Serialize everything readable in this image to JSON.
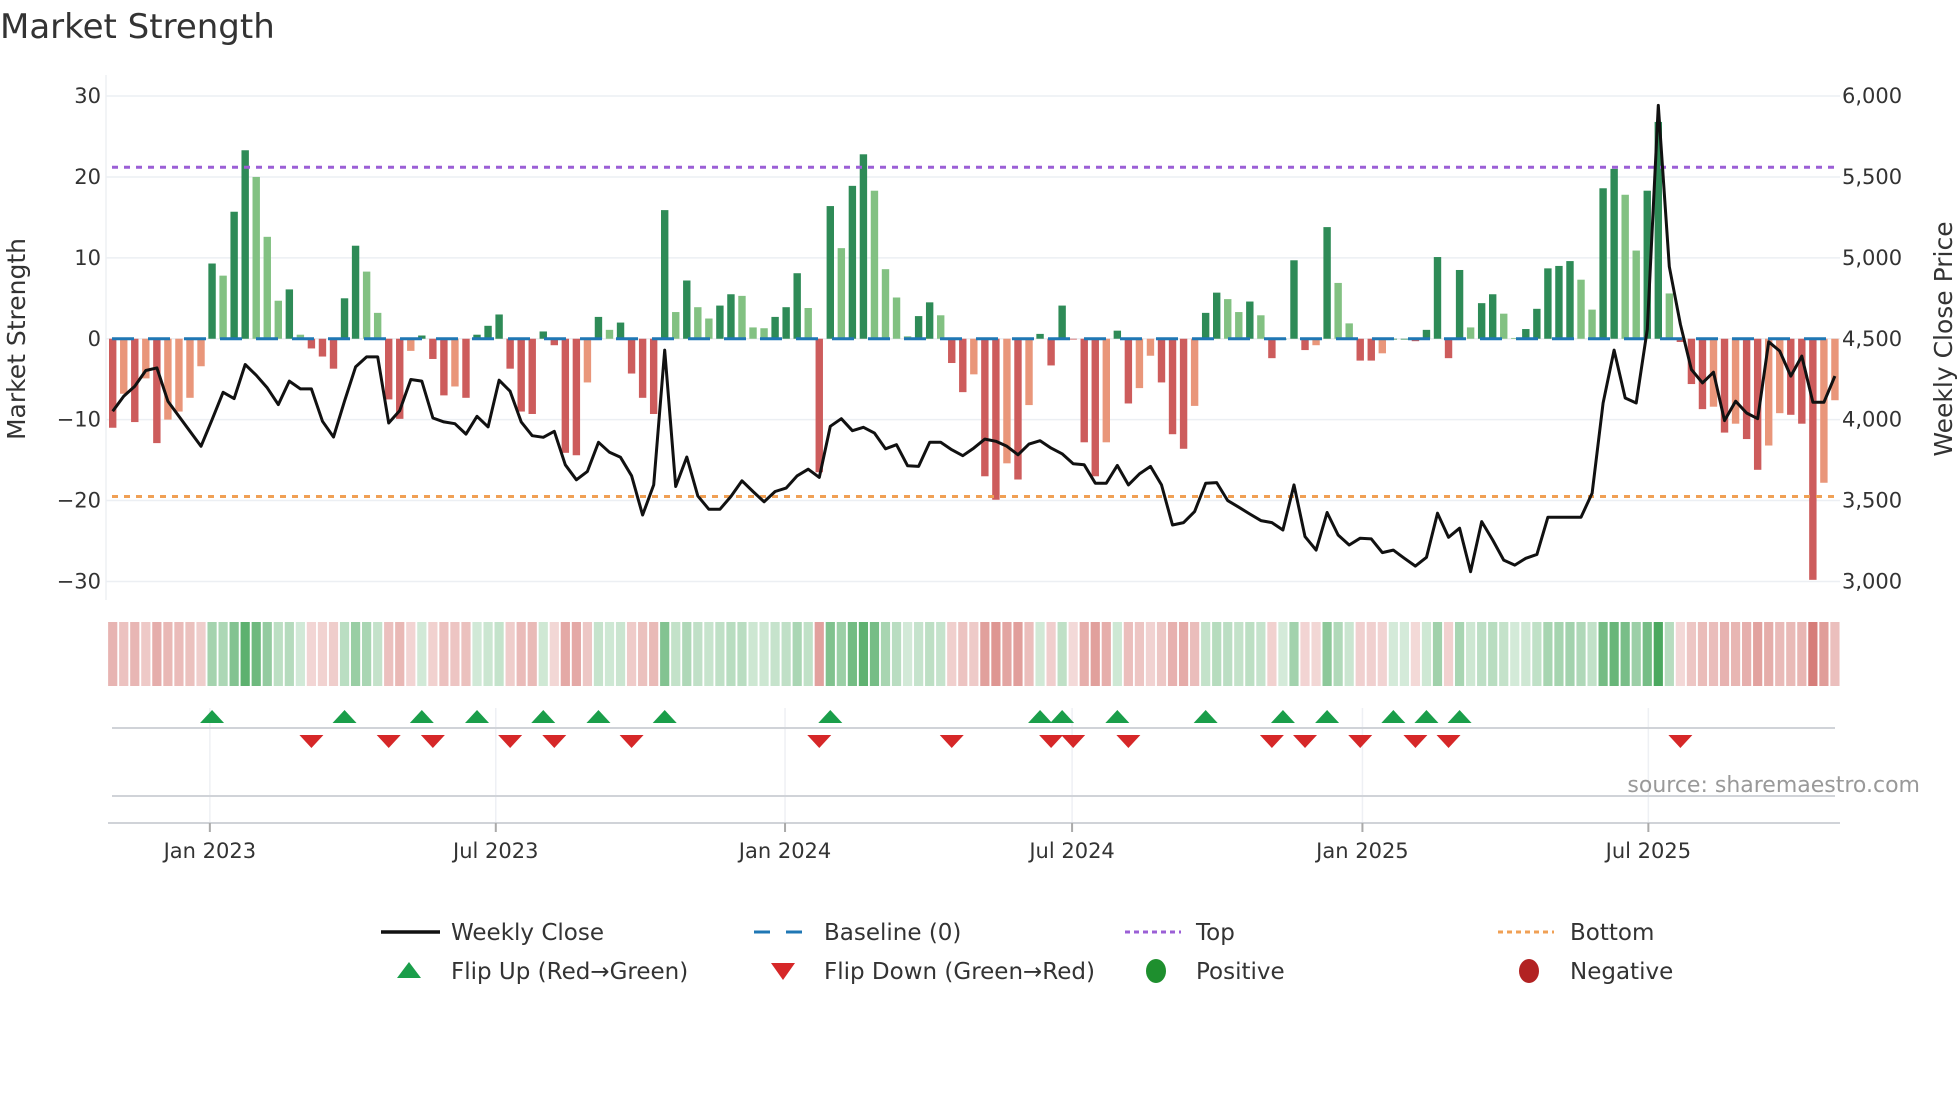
{
  "chart_data": {
    "type": "bar",
    "title": "Market Strength",
    "ylabel": "Market Strength",
    "y2label": "Weekly Close Price",
    "ylim": [
      -30,
      30
    ],
    "y2lim": [
      3000,
      6000
    ],
    "y_ticks": [
      "30",
      "20",
      "10",
      "0",
      "−10",
      "−20",
      "−30"
    ],
    "y_tick_values": [
      30,
      20,
      10,
      0,
      -10,
      -20,
      -30
    ],
    "y2_ticks": [
      "6,000",
      "5,500",
      "5,000",
      "4,500",
      "4,000",
      "3,500",
      "3,000"
    ],
    "y2_tick_values": [
      6000,
      5500,
      5000,
      4500,
      4000,
      3500,
      3000
    ],
    "x_ticks": [
      {
        "label": "Jan 2023",
        "week_index": 8.8
      },
      {
        "label": "Jul 2023",
        "week_index": 34.7
      },
      {
        "label": "Jan 2024",
        "week_index": 60.9
      },
      {
        "label": "Jul 2024",
        "week_index": 86.9
      },
      {
        "label": "Jan 2025",
        "week_index": 113.2
      },
      {
        "label": "Jul 2025",
        "week_index": 139.1
      }
    ],
    "top_level": 21.2,
    "bottom_level": -19.5,
    "baseline": 0,
    "strength": [
      -11.0,
      -6.8,
      -10.3,
      -4.9,
      -12.9,
      -10.0,
      -9.0,
      -7.3,
      -3.4,
      9.3,
      7.8,
      15.7,
      23.3,
      20.0,
      12.6,
      4.7,
      6.1,
      0.5,
      -1.2,
      -2.2,
      -3.7,
      5.0,
      11.5,
      8.3,
      3.2,
      -7.5,
      -9.9,
      -1.5,
      0.4,
      -2.5,
      -7.0,
      -5.9,
      -7.3,
      0.5,
      1.6,
      3.0,
      -3.7,
      -9.0,
      -9.3,
      0.9,
      -0.8,
      -14.1,
      -14.4,
      -5.4,
      2.7,
      1.1,
      2.0,
      -4.3,
      -7.3,
      -9.3,
      15.9,
      3.3,
      7.2,
      3.9,
      2.5,
      4.1,
      5.5,
      5.3,
      1.4,
      1.3,
      2.7,
      3.9,
      8.1,
      3.8,
      -16.5,
      16.4,
      11.2,
      18.9,
      22.8,
      18.3,
      8.6,
      5.1,
      0.3,
      2.8,
      4.5,
      2.9,
      -3.0,
      -6.6,
      -4.4,
      -17.0,
      -19.9,
      -15.4,
      -17.4,
      -8.2,
      0.6,
      -3.3,
      4.1,
      -0.1,
      -12.8,
      -17.0,
      -12.8,
      1.0,
      -8.0,
      -6.1,
      -2.1,
      -5.4,
      -11.8,
      -13.6,
      -8.3,
      3.2,
      5.7,
      4.9,
      3.3,
      4.6,
      2.9,
      -2.4,
      0,
      9.7,
      -1.4,
      -0.8,
      13.8,
      6.9,
      1.9,
      -2.7,
      -2.7,
      -1.8,
      0,
      0,
      -0.3,
      1.1,
      10.1,
      -2.4,
      8.5,
      1.4,
      4.4,
      5.5,
      3.1,
      0.1,
      1.2,
      3.7,
      8.7,
      9.0,
      9.6,
      7.3,
      3.6,
      18.6,
      21.0,
      17.8,
      10.9,
      18.3,
      26.8,
      5.6,
      -0.4,
      -5.6,
      -8.7,
      -8.4,
      -11.6,
      -10.5,
      -12.4,
      -16.2,
      -13.2,
      -9.2,
      -9.4,
      -10.5,
      -29.8,
      -17.8,
      -7.6
    ],
    "weekly_close": [
      4052,
      4145,
      4207,
      4304,
      4320,
      4114,
      4021,
      3928,
      3835,
      4000,
      4169,
      4130,
      4341,
      4275,
      4196,
      4093,
      4238,
      4190,
      4190,
      3990,
      3893,
      4114,
      4326,
      4388,
      4388,
      3979,
      4056,
      4248,
      4238,
      4010,
      3986,
      3975,
      3911,
      4021,
      3955,
      4244,
      4176,
      3986,
      3901,
      3891,
      3928,
      3721,
      3628,
      3680,
      3860,
      3798,
      3767,
      3653,
      3411,
      3597,
      4430,
      3587,
      3769,
      3529,
      3446,
      3446,
      3525,
      3622,
      3556,
      3492,
      3556,
      3577,
      3653,
      3694,
      3643,
      3959,
      4006,
      3932,
      3953,
      3917,
      3820,
      3845,
      3715,
      3711,
      3860,
      3860,
      3814,
      3777,
      3824,
      3880,
      3866,
      3835,
      3783,
      3849,
      3870,
      3824,
      3789,
      3727,
      3721,
      3607,
      3607,
      3717,
      3597,
      3665,
      3711,
      3597,
      3349,
      3364,
      3432,
      3607,
      3611,
      3500,
      3459,
      3417,
      3376,
      3364,
      3318,
      3597,
      3277,
      3194,
      3426,
      3287,
      3225,
      3267,
      3263,
      3178,
      3194,
      3143,
      3095,
      3149,
      3422,
      3273,
      3329,
      3060,
      3370,
      3256,
      3132,
      3101,
      3143,
      3167,
      3397,
      3397,
      3397,
      3397,
      3545,
      4103,
      4430,
      4134,
      4103,
      4558,
      5942,
      4946,
      4589,
      4310,
      4227,
      4293,
      3994,
      4114,
      4041,
      4006,
      4481,
      4424,
      4269,
      4393,
      4107,
      4107,
      4269
    ],
    "flip_up_weeks": [
      9,
      21,
      28,
      33,
      39,
      44,
      50,
      65,
      84,
      86,
      91,
      99,
      106,
      110,
      116,
      119,
      122
    ],
    "flip_down_weeks": [
      18,
      25,
      29,
      36,
      40,
      47,
      64,
      76,
      85,
      87,
      92,
      105,
      108,
      113,
      118,
      121,
      142
    ],
    "legend": [
      {
        "label": "Weekly Close",
        "symbol": "line"
      },
      {
        "label": "Baseline (0)",
        "symbol": "dash"
      },
      {
        "label": "Top",
        "symbol": "dot-purple"
      },
      {
        "label": "Bottom",
        "symbol": "dot-orange"
      },
      {
        "label": "Flip Up (Red→Green)",
        "symbol": "triangle-up"
      },
      {
        "label": "Flip Down (Green→Red)",
        "symbol": "triangle-down"
      },
      {
        "label": "Positive",
        "symbol": "circle-green"
      },
      {
        "label": "Negative",
        "symbol": "circle-red"
      }
    ],
    "legend_placement": "bottom",
    "colors": {
      "green_rising": "#2e8b57",
      "green_falling": "#82c182",
      "red_falling": "#cd5c5c",
      "red_rising": "#e9967a",
      "close": "#111111",
      "baseline": "#1f77b4",
      "top": "#9b5fd6",
      "bottom": "#f0a055",
      "flip_up": "#1a9e4a",
      "flip_down": "#d62728",
      "positive": "#1e8f2e",
      "negative": "#b22222"
    }
  },
  "source": "source: sharemaestro.com"
}
